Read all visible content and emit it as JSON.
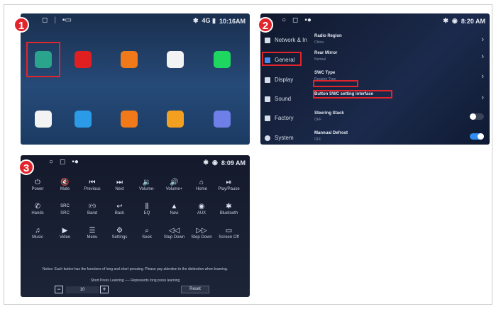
{
  "colors": {
    "accent_red": "#e2252c",
    "toggle_blue": "#2f8cf0"
  },
  "badges": [
    "1",
    "2",
    "3"
  ],
  "screen1": {
    "status_time": "10:16AM",
    "apps": [
      {
        "icon": "car-settings-icon",
        "color": "#2aa48c",
        "label": ""
      },
      {
        "icon": "youtube-icon",
        "color": "#e02020",
        "label": ""
      },
      {
        "icon": "equalizer-icon",
        "color": "#f07a1a",
        "label": ""
      },
      {
        "icon": "photos-icon",
        "color": "#f3f3f3",
        "label": ""
      },
      {
        "icon": "spotify-icon",
        "color": "#1ed760",
        "label": ""
      },
      {
        "icon": "google-icon",
        "color": "#f3f3f3",
        "label": ""
      },
      {
        "icon": "files-icon",
        "color": "#2b9be8",
        "label": ""
      },
      {
        "icon": "music-eq-icon",
        "color": "#f07a1a",
        "label": ""
      },
      {
        "icon": "notes-icon",
        "color": "#f3a020",
        "label": ""
      },
      {
        "icon": "gallery-icon",
        "color": "#6f7fe8",
        "label": ""
      }
    ]
  },
  "screen2": {
    "status_time": "8:20 AM",
    "sidebar": [
      {
        "label": "Network & In",
        "icon": "wifi-icon"
      },
      {
        "label": "General",
        "icon": "general-icon"
      },
      {
        "label": "Display",
        "icon": "display-icon"
      },
      {
        "label": "Sound",
        "icon": "sound-icon"
      },
      {
        "label": "Factory",
        "icon": "factory-icon"
      },
      {
        "label": "System",
        "icon": "info-icon"
      }
    ],
    "settings": [
      {
        "title": "Radio Region",
        "sub": "China",
        "control": "chevron"
      },
      {
        "title": "Rear Mirror",
        "sub": "Normal",
        "control": "chevron"
      },
      {
        "title": "SWC Type",
        "sub": "Resistor Type",
        "control": "chevron"
      },
      {
        "title": "Button SWC setting interface",
        "sub": "",
        "control": "chevron"
      },
      {
        "title": "Steering Stack",
        "sub": "OFF",
        "control": "toggle-off"
      },
      {
        "title": "Mannual Defrost",
        "sub": "OFF",
        "control": "toggle-on"
      }
    ]
  },
  "screen3": {
    "status_time": "8:09 AM",
    "keys": [
      {
        "label": "Power",
        "glyph": "⏻",
        "icon": "power-icon"
      },
      {
        "label": "Mute",
        "glyph": "🔇",
        "icon": "mute-icon"
      },
      {
        "label": "Previous",
        "glyph": "⏮",
        "icon": "previous-icon"
      },
      {
        "label": "Next",
        "glyph": "⏭",
        "icon": "next-icon"
      },
      {
        "label": "Volume-",
        "glyph": "🔉",
        "icon": "volume-down-icon"
      },
      {
        "label": "Volume+",
        "glyph": "🔊",
        "icon": "volume-up-icon"
      },
      {
        "label": "Home",
        "glyph": "⌂",
        "icon": "home-icon"
      },
      {
        "label": "Play/Pause",
        "glyph": "⏯",
        "icon": "play-pause-icon"
      },
      {
        "label": "Hands",
        "glyph": "✆",
        "icon": "handsfree-icon"
      },
      {
        "label": "SRC",
        "glyph": "SRC",
        "icon": "src-icon"
      },
      {
        "label": "Band",
        "glyph": "((•))",
        "icon": "band-icon"
      },
      {
        "label": "Back",
        "glyph": "↩",
        "icon": "back-icon"
      },
      {
        "label": "EQ",
        "glyph": "⫼",
        "icon": "eq-icon"
      },
      {
        "label": "Navi",
        "glyph": "▲",
        "icon": "navi-icon"
      },
      {
        "label": "AUX",
        "glyph": "◉",
        "icon": "aux-icon"
      },
      {
        "label": "Bluetooth",
        "glyph": "✱",
        "icon": "bluetooth-icon"
      },
      {
        "label": "Music",
        "glyph": "♫",
        "icon": "music-icon"
      },
      {
        "label": "Video",
        "glyph": "▶",
        "icon": "video-icon"
      },
      {
        "label": "Menu",
        "glyph": "☰",
        "icon": "menu-icon"
      },
      {
        "label": "Settings",
        "glyph": "⚙",
        "icon": "settings-icon"
      },
      {
        "label": "Seek",
        "glyph": "⌕",
        "icon": "seek-icon"
      },
      {
        "label": "Step Down",
        "glyph": "◁◁",
        "icon": "step-down-icon"
      },
      {
        "label": "Step Down",
        "glyph": "▷▷",
        "icon": "step-up-icon"
      },
      {
        "label": "Screen Off",
        "glyph": "▭",
        "icon": "screen-off-icon"
      }
    ],
    "notice": "Notice: Each button has the functions of long and short pressing. Please pay attention to the distinction when learning.",
    "legend": "Short Press Learning ---- Represents long press learning",
    "minus": "−",
    "value": "10",
    "plus": "+",
    "reset": "Reset"
  }
}
